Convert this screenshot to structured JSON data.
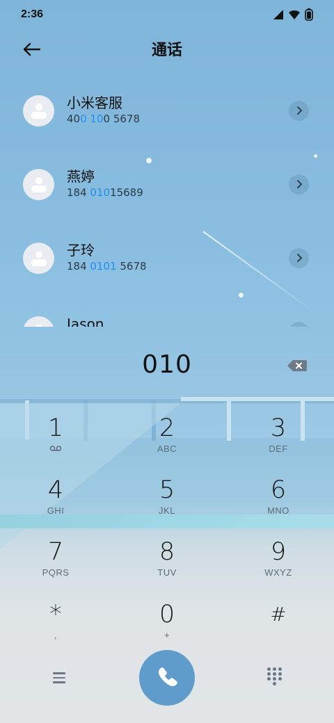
{
  "status_bar": {
    "time": "2:36",
    "icons": [
      "signal-icon",
      "wifi-icon",
      "battery-icon"
    ]
  },
  "header": {
    "back_icon": "arrow-left-icon",
    "title": "通话"
  },
  "contacts": [
    {
      "name": "小米客服",
      "number_parts": [
        "40",
        "0",
        " ",
        "10",
        "0 5678"
      ]
    },
    {
      "name": "燕婷",
      "number_parts": [
        "184 ",
        "010",
        "15689"
      ]
    },
    {
      "name": "子玲",
      "number_parts": [
        "184 ",
        "0101",
        " 5678"
      ]
    },
    {
      "name": "Jason",
      "number_parts": []
    }
  ],
  "dialer": {
    "input_value": "010",
    "backspace_icon": "backspace-icon"
  },
  "keypad": [
    {
      "digit": "1",
      "letters": ""
    },
    {
      "digit": "2",
      "letters": "ABC"
    },
    {
      "digit": "3",
      "letters": "DEF"
    },
    {
      "digit": "4",
      "letters": "GHI"
    },
    {
      "digit": "5",
      "letters": "JKL"
    },
    {
      "digit": "6",
      "letters": "MNO"
    },
    {
      "digit": "7",
      "letters": "PQRS"
    },
    {
      "digit": "8",
      "letters": "TUV"
    },
    {
      "digit": "9",
      "letters": "WXYZ"
    },
    {
      "digit": "*",
      "letters": ","
    },
    {
      "digit": "0",
      "letters": "+"
    },
    {
      "digit": "#",
      "letters": ""
    }
  ],
  "bottom_bar": {
    "menu_icon": "menu-icon",
    "call_icon": "phone-icon",
    "keypad_icon": "dialpad-icon"
  },
  "colors": {
    "highlight": "#1f8ff0",
    "call_button": "#5f9ccc"
  }
}
